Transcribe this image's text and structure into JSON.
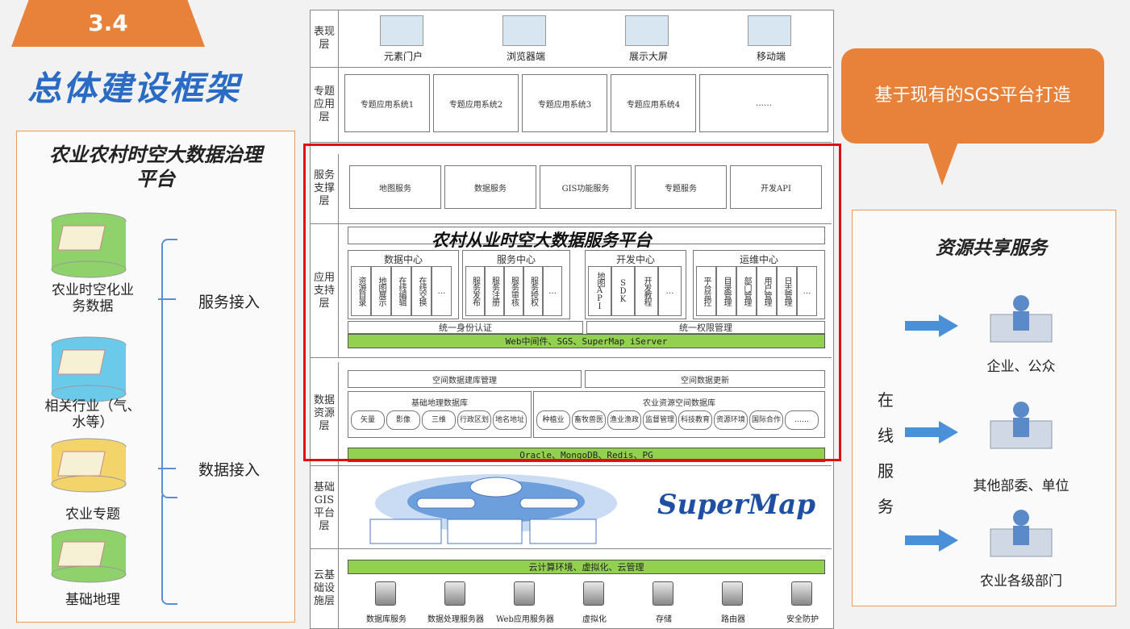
{
  "section_number": "3.4",
  "page_title": "总体建设框架",
  "left_panel": {
    "title_line1": "农业农村时空大数据治理",
    "title_line2": "平台",
    "items": [
      {
        "label": "农业时空化业\n务数据",
        "icon": "database-map-icon",
        "color": "#8fd16b"
      },
      {
        "label": "相关行业（气、\n水等）",
        "icon": "database-map-icon",
        "color": "#6bc9ea"
      },
      {
        "label": "农业专题",
        "icon": "database-map-icon",
        "color": "#f2d46b"
      },
      {
        "label": "基础地理",
        "icon": "database-map-icon",
        "color": "#8fd16b"
      }
    ],
    "service_access": "服务接入",
    "data_access": "数据接入"
  },
  "diagram": {
    "layers": {
      "presentation": "表现层",
      "topic_app": "专题应用层",
      "service_support": "服务支撑层",
      "app_support": "应用支持层",
      "data_resource": "数据资源层",
      "base_gis": "基础GIS平台层",
      "cloud_infra": "云基础设施层"
    },
    "presentation_items": [
      "元素门户",
      "浏览器端",
      "展示大屏",
      "移动端"
    ],
    "topic_items": [
      "专题应用系统1",
      "专题应用系统2",
      "专题应用系统3",
      "专题应用系统4",
      "……"
    ],
    "service_items": [
      "地图服务",
      "数据服务",
      "GIS功能服务",
      "专题服务",
      "开发API"
    ],
    "platform_name": "农村从业时空大数据服务平台",
    "centers": [
      {
        "name": "数据中心",
        "items": [
          "资源目录",
          "地图展示",
          "在线编辑",
          "在线交换",
          "…"
        ]
      },
      {
        "name": "服务中心",
        "items": [
          "服务发布",
          "服务注册",
          "服务审核",
          "服务授权",
          "…"
        ]
      },
      {
        "name": "开发中心",
        "items": [
          "地图API",
          "SDK",
          "开发教程",
          "…"
        ]
      },
      {
        "name": "运维中心",
        "items": [
          "平台监控",
          "目录管理",
          "部门管理",
          "用户管理",
          "日志管理",
          "…"
        ]
      }
    ],
    "unified_auth": "统一身份认证",
    "unified_perm": "统一权限管理",
    "middleware": "Web中间件、SGS、SuperMap iServer",
    "db_build": "空间数据建库管理",
    "db_update": "空间数据更新",
    "base_geo_db": "基础地理数据库",
    "base_geo_items": [
      "矢量",
      "影像",
      "三维",
      "行政区划",
      "地名地址"
    ],
    "agri_db": "农业资源空间数据库",
    "agri_items": [
      "种植业",
      "畜牧兽医",
      "渔业渔政",
      "监督管理",
      "科技教育",
      "资源环境",
      "国际合作",
      "……"
    ],
    "db_engines": "Oracle、MongoDB、Redis、PG",
    "supermap_logo": "SuperMap",
    "cloud_env": "云计算环境、虚拟化、云管理",
    "infra_items": [
      "数据库服务",
      "数据处理服务器",
      "Web应用服务器",
      "虚拟化",
      "存储",
      "路由器",
      "安全防护"
    ]
  },
  "callout": "基于现有的SGS平台打造",
  "right_panel": {
    "title": "资源共享服务",
    "online_service": [
      "在",
      "线",
      "服",
      "务"
    ],
    "targets": [
      {
        "label": "企业、公众",
        "icon": "office-worker-icon"
      },
      {
        "label": "其他部委、单位",
        "icon": "server-room-icon"
      },
      {
        "label": "农业各级部门",
        "icon": "desk-worker-icon"
      }
    ]
  },
  "colors": {
    "accent": "#e8823a",
    "title_blue": "#2a6bc4",
    "highlight_red": "#e01010",
    "bar_green": "#92d050",
    "arrow_blue": "#4a90d9"
  }
}
